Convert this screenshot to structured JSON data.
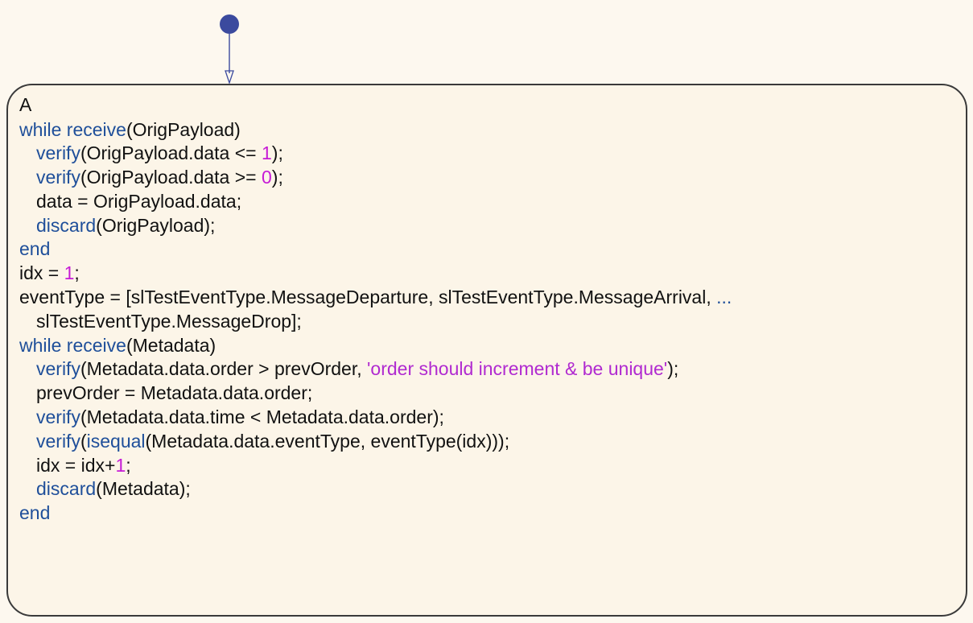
{
  "colors": {
    "background": "#fdf8ef",
    "state_fill": "#fcf5e8",
    "state_border": "#3a3a3a",
    "default_text": "#111111",
    "keyword": "#1f4f9a",
    "number": "#c61bd6",
    "string": "#b02ad0",
    "default_transition": "#3b4a9e"
  },
  "default_transition": {
    "dot_color": "#3b4a9e",
    "arrow_color": "#3b4a9e"
  },
  "state": {
    "name": "A",
    "lines": [
      {
        "indent": 0,
        "segments": [
          {
            "text": "while receive",
            "style": "keyword"
          },
          {
            "text": "(OrigPayload)",
            "style": "plain"
          }
        ]
      },
      {
        "indent": 1,
        "segments": [
          {
            "text": "verify",
            "style": "keyword"
          },
          {
            "text": "(OrigPayload.data <= ",
            "style": "plain"
          },
          {
            "text": "1",
            "style": "number"
          },
          {
            "text": ");",
            "style": "plain"
          }
        ]
      },
      {
        "indent": 1,
        "segments": [
          {
            "text": "verify",
            "style": "keyword"
          },
          {
            "text": "(OrigPayload.data >= ",
            "style": "plain"
          },
          {
            "text": "0",
            "style": "number"
          },
          {
            "text": ");",
            "style": "plain"
          }
        ]
      },
      {
        "indent": 1,
        "segments": [
          {
            "text": "data = OrigPayload.data;",
            "style": "plain"
          }
        ]
      },
      {
        "indent": 1,
        "segments": [
          {
            "text": "discard",
            "style": "keyword"
          },
          {
            "text": "(OrigPayload);",
            "style": "plain"
          }
        ]
      },
      {
        "indent": 0,
        "segments": [
          {
            "text": "end",
            "style": "keyword"
          }
        ]
      },
      {
        "indent": 0,
        "segments": [
          {
            "text": "idx = ",
            "style": "plain"
          },
          {
            "text": "1",
            "style": "number"
          },
          {
            "text": ";",
            "style": "plain"
          }
        ]
      },
      {
        "indent": 0,
        "segments": [
          {
            "text": "eventType = [slTestEventType.MessageDeparture, slTestEventType.MessageArrival, ",
            "style": "plain"
          },
          {
            "text": "...",
            "style": "keyword"
          }
        ]
      },
      {
        "indent": 1,
        "segments": [
          {
            "text": "slTestEventType.MessageDrop];",
            "style": "plain"
          }
        ]
      },
      {
        "indent": 0,
        "segments": [
          {
            "text": "while receive",
            "style": "keyword"
          },
          {
            "text": "(Metadata)",
            "style": "plain"
          }
        ]
      },
      {
        "indent": 1,
        "segments": [
          {
            "text": "verify",
            "style": "keyword"
          },
          {
            "text": "(Metadata.data.order > prevOrder, ",
            "style": "plain"
          },
          {
            "text": "'order should increment & be unique'",
            "style": "string"
          },
          {
            "text": ");",
            "style": "plain"
          }
        ]
      },
      {
        "indent": 1,
        "segments": [
          {
            "text": "prevOrder = Metadata.data.order;",
            "style": "plain"
          }
        ]
      },
      {
        "indent": 1,
        "segments": [
          {
            "text": "verify",
            "style": "keyword"
          },
          {
            "text": "(Metadata.data.time < Metadata.data.order);",
            "style": "plain"
          }
        ]
      },
      {
        "indent": 1,
        "segments": [
          {
            "text": "verify",
            "style": "keyword"
          },
          {
            "text": "(",
            "style": "plain"
          },
          {
            "text": "isequal",
            "style": "keyword"
          },
          {
            "text": "(Metadata.data.eventType, eventType(idx)));",
            "style": "plain"
          }
        ]
      },
      {
        "indent": 1,
        "segments": [
          {
            "text": "idx = idx+",
            "style": "plain"
          },
          {
            "text": "1",
            "style": "number"
          },
          {
            "text": ";",
            "style": "plain"
          }
        ]
      },
      {
        "indent": 1,
        "segments": [
          {
            "text": "discard",
            "style": "keyword"
          },
          {
            "text": "(Metadata);",
            "style": "plain"
          }
        ]
      },
      {
        "indent": 0,
        "segments": [
          {
            "text": "end",
            "style": "keyword"
          }
        ]
      }
    ]
  }
}
